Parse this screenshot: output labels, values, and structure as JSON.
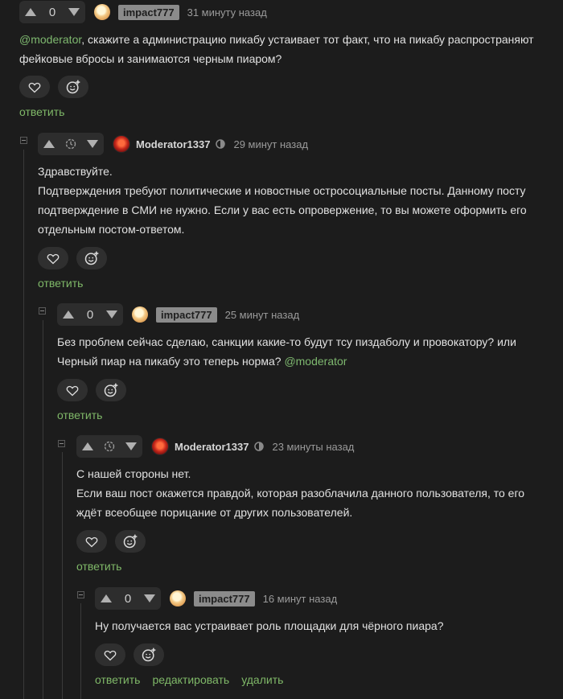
{
  "colors": {
    "background": "#1c1c1c",
    "link": "#7fb868",
    "mention": "#7eb86f",
    "username_badge": "#8b8b8b"
  },
  "icons": {
    "upvote": "arrow-up-icon",
    "downvote": "arrow-down-icon",
    "score_hidden": "clock-icon",
    "like": "heart-icon",
    "react": "emoji-add-icon",
    "moderator_badge": "moderator-badge-icon"
  },
  "comments": [
    {
      "score": "0",
      "author": "impact777",
      "time": "31 минуту назад",
      "mention": "@moderator",
      "text": ", скажите а администрацию пикабу устаивает тот факт, что на пикабу распространяют фейковые вбросы и занимаются черным пиаром?",
      "reply_label": "ответить"
    },
    {
      "author": "Moderator1337",
      "time": "29 минут назад",
      "lines": [
        "Здравствуйте.",
        "Подтверждения требуют политические и новостные остросоциальные посты. Данному посту подтверждение в СМИ не нужно. Если у вас есть опровержение, то вы можете оформить его отдельным постом-ответом."
      ],
      "reply_label": "ответить"
    },
    {
      "score": "0",
      "author": "impact777",
      "time": "25 минут назад",
      "text": "Без проблем сейчас сделаю, санкции какие-то будут тсу пиздаболу и провокатору? или Черный пиар на пикабу это теперь норма? ",
      "mention": "@moderator",
      "reply_label": "ответить"
    },
    {
      "author": "Moderator1337",
      "time": "23 минуты назад",
      "lines": [
        "С нашей стороны нет.",
        "Если ваш пост окажется правдой, которая разоблачила данного пользователя, то его ждёт всеобщее порицание от других пользователей."
      ],
      "reply_label": "ответить"
    },
    {
      "score": "0",
      "author": "impact777",
      "time": "16 минут назад",
      "text": "Ну получается вас устраивает роль площадки для чёрного пиара?",
      "reply_label": "ответить",
      "edit_label": "редактировать",
      "delete_label": "удалить"
    }
  ]
}
